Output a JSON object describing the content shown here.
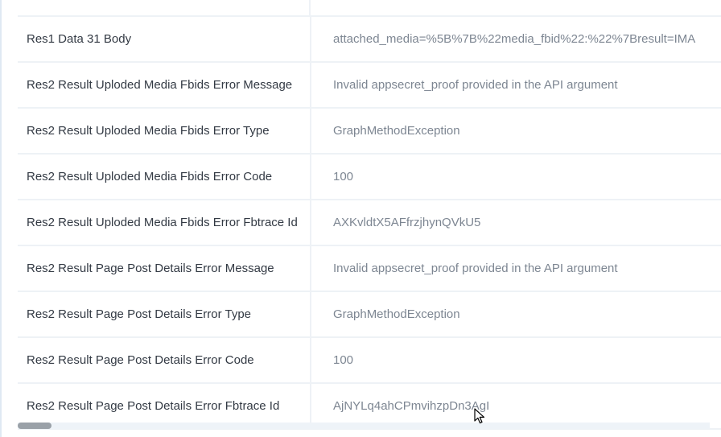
{
  "rows": [
    {
      "key": "Res1 Data 31 Body",
      "value": "attached_media=%5B%7B%22media_fbid%22:%22%7Bresult=IMA"
    },
    {
      "key": "Res2 Result Uploded Media Fbids Error Message",
      "value": "Invalid appsecret_proof provided in the API argument"
    },
    {
      "key": "Res2 Result Uploded Media Fbids Error Type",
      "value": "GraphMethodException"
    },
    {
      "key": "Res2 Result Uploded Media Fbids Error Code",
      "value": "100"
    },
    {
      "key": "Res2 Result Uploded Media Fbids Error Fbtrace Id",
      "value": "AXKvldtX5AFfrzjhynQVkU5"
    },
    {
      "key": "Res2 Result Page Post Details Error Message",
      "value": "Invalid appsecret_proof provided in the API argument"
    },
    {
      "key": "Res2 Result Page Post Details Error Type",
      "value": "GraphMethodException"
    },
    {
      "key": "Res2 Result Page Post Details Error Code",
      "value": "100"
    },
    {
      "key": "Res2 Result Page Post Details Error Fbtrace Id",
      "value": "AjNYLq4ahCPmvihzpDn3AgI"
    }
  ],
  "scrollbar": {
    "horizontal_position": 0
  },
  "icons": {
    "cursor": "mouse-pointer-icon"
  }
}
